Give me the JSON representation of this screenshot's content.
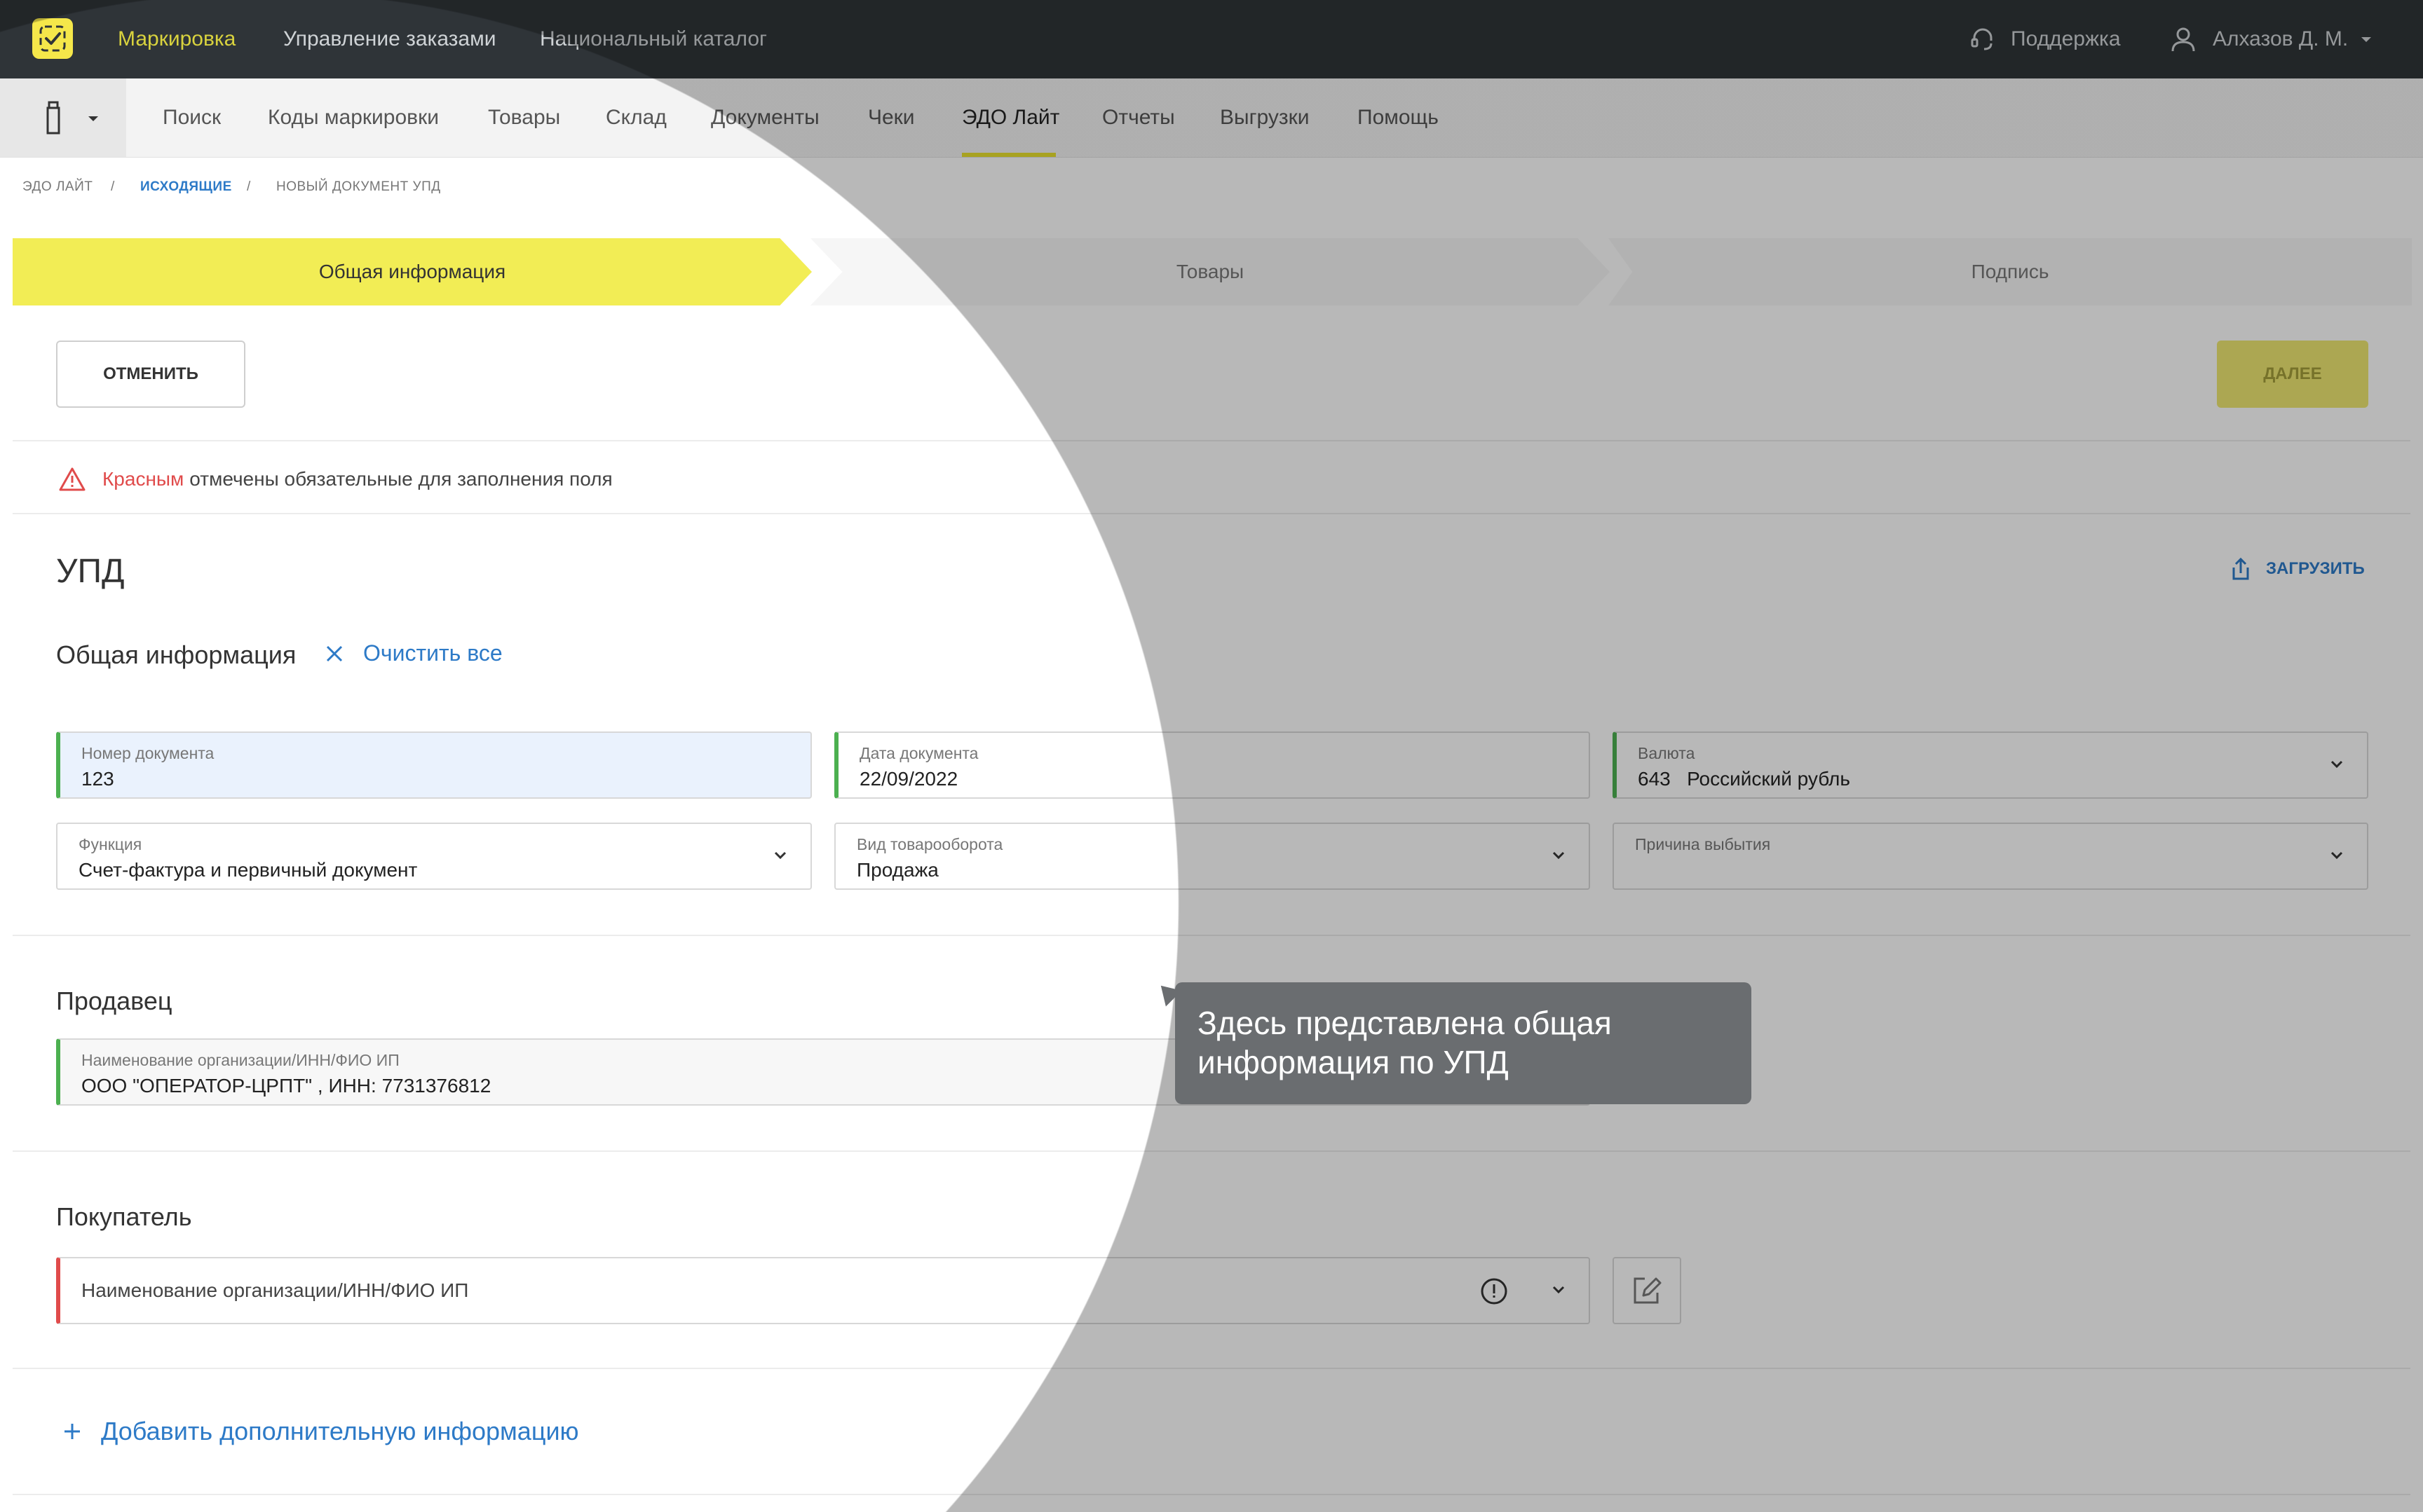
{
  "topbar": {
    "nav": [
      "Маркировка",
      "Управление заказами",
      "Национальный каталог"
    ],
    "support": "Поддержка",
    "user": "Алхазов Д. М."
  },
  "subnav": {
    "items": [
      "Поиск",
      "Коды маркировки",
      "Товары",
      "Склад",
      "Документы",
      "Чеки",
      "ЭДО Лайт",
      "Отчеты",
      "Выгрузки",
      "Помощь"
    ],
    "active": "ЭДО Лайт"
  },
  "breadcrumbs": [
    "ЭДО ЛАЙТ",
    "ИСХОДЯЩИЕ",
    "НОВЫЙ ДОКУМЕНТ УПД"
  ],
  "steps": [
    "Общая информация",
    "Товары",
    "Подпись"
  ],
  "buttons": {
    "cancel": "ОТМЕНИТЬ",
    "next": "ДАЛЕЕ",
    "upload": "ЗАГРУЗИТЬ"
  },
  "warning": {
    "red_word": "Красным",
    "rest": "отмечены обязательные для заполнения поля"
  },
  "title": "УПД",
  "general": {
    "title": "Общая информация",
    "clear_all": "Очистить все",
    "doc_number": {
      "label": "Номер документа",
      "value": "123"
    },
    "doc_date": {
      "label": "Дата документа",
      "value": "22/09/2022"
    },
    "currency": {
      "label": "Валюта",
      "code": "643",
      "name": "Российский рубль"
    },
    "function": {
      "label": "Функция",
      "value": "Счет-фактура и первичный документ"
    },
    "turnover": {
      "label": "Вид товарооборота",
      "value": "Продажа"
    },
    "withdrawal": {
      "label": "Причина выбытия",
      "value": ""
    }
  },
  "seller": {
    "title": "Продавец",
    "label": "Наименование организации/ИНН/ФИО ИП",
    "value": "ООО \"ОПЕРАТОР-ЦРПТ\" , ИНН: 7731376812"
  },
  "buyer": {
    "title": "Покупатель",
    "placeholder": "Наименование организации/ИНН/ФИО ИП"
  },
  "add_info": "Добавить дополнительную информацию",
  "tooltip": "Здесь представлена общая информация по УПД",
  "colors": {
    "accent_yellow": "#f2ed55",
    "link_blue": "#2d7ac7",
    "required_red": "#e04b4b",
    "valid_green": "#4cb050",
    "topbar": "#2f3438"
  }
}
